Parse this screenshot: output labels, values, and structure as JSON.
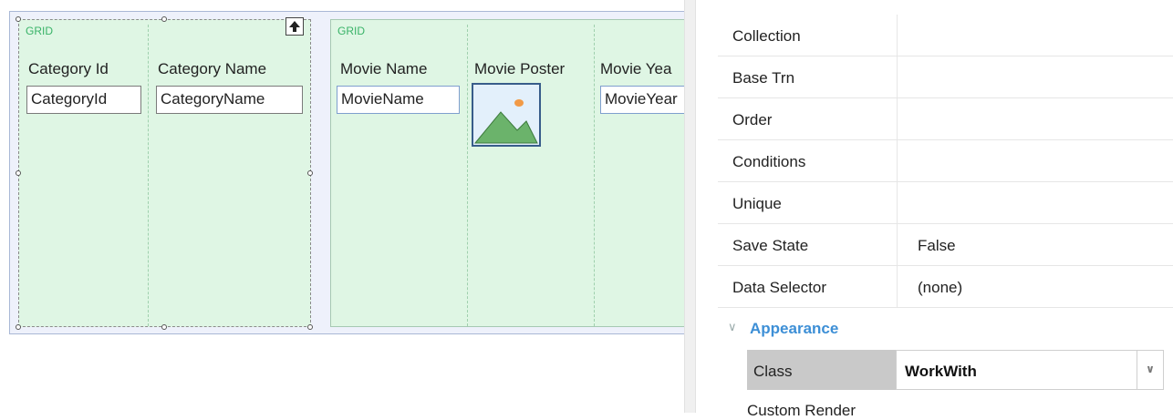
{
  "designer": {
    "grid1": {
      "tag": "GRID",
      "columns": [
        {
          "header": "Category Id",
          "field": "CategoryId"
        },
        {
          "header": "Category Name",
          "field": "CategoryName"
        }
      ]
    },
    "grid2": {
      "tag": "GRID",
      "columns": [
        {
          "header": "Movie Name",
          "field": "MovieName"
        },
        {
          "header": "Movie Poster",
          "field": "image-placeholder-icon"
        },
        {
          "header": "Movie Yea",
          "field": "MovieYear"
        }
      ]
    }
  },
  "properties": {
    "rows": [
      {
        "name": "Collection",
        "value": ""
      },
      {
        "name": "Base Trn",
        "value": ""
      },
      {
        "name": "Order",
        "value": ""
      },
      {
        "name": "Conditions",
        "value": ""
      },
      {
        "name": "Unique",
        "value": ""
      },
      {
        "name": "Save State",
        "value": "False"
      },
      {
        "name": "Data Selector",
        "value": "(none)"
      }
    ],
    "section": "Appearance",
    "class_row": {
      "name": "Class",
      "value": "WorkWith"
    },
    "next_row_partial": "Custom Render"
  },
  "colors": {
    "grid_bg": "#dff6e4",
    "grid_tag": "#39b368",
    "section_title": "#3d8fd6",
    "selected_row_bg": "#c9c9c9"
  }
}
